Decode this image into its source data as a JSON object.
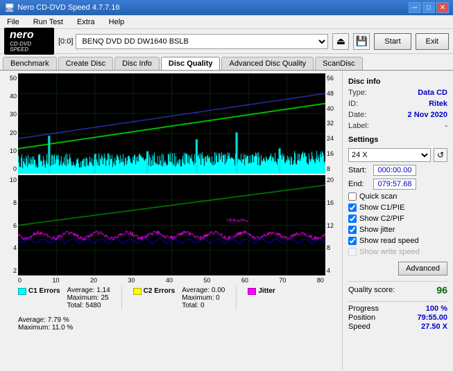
{
  "titleBar": {
    "title": "Nero CD-DVD Speed 4.7.7.16",
    "icon": "●",
    "controls": [
      "─",
      "□",
      "✕"
    ]
  },
  "menuBar": {
    "items": [
      "File",
      "Run Test",
      "Extra",
      "Help"
    ]
  },
  "toolbar": {
    "logo_top": "nero",
    "logo_bottom": "CD·DVD SPEED",
    "drive_label": "[0:0]",
    "drive_value": "BENQ DVD DD DW1640 BSLB",
    "eject_icon": "⏏",
    "save_icon": "💾",
    "start_label": "Start",
    "exit_label": "Exit"
  },
  "tabs": [
    {
      "label": "Benchmark",
      "active": false
    },
    {
      "label": "Create Disc",
      "active": false
    },
    {
      "label": "Disc Info",
      "active": false
    },
    {
      "label": "Disc Quality",
      "active": true
    },
    {
      "label": "Advanced Disc Quality",
      "active": false
    },
    {
      "label": "ScanDisc",
      "active": false
    }
  ],
  "topChart": {
    "yLeft": [
      "50",
      "40",
      "30",
      "20",
      "10",
      "0"
    ],
    "yRight": [
      "56",
      "48",
      "40",
      "32",
      "24",
      "16",
      "8"
    ],
    "xAxis": [
      "0",
      "10",
      "20",
      "30",
      "40",
      "50",
      "60",
      "70",
      "80"
    ]
  },
  "bottomChart": {
    "yLeft": [
      "10",
      "8",
      "6",
      "4",
      "2"
    ],
    "yRight": [
      "20",
      "16",
      "12",
      "8",
      "4"
    ],
    "xAxis": [
      "0",
      "10",
      "20",
      "30",
      "40",
      "50",
      "60",
      "70",
      "80"
    ]
  },
  "stats": {
    "c1": {
      "label": "C1 Errors",
      "color": "#00ffff",
      "average_label": "Average:",
      "average_val": "1.14",
      "maximum_label": "Maximum:",
      "maximum_val": "25",
      "total_label": "Total:",
      "total_val": "5480"
    },
    "c2": {
      "label": "C2 Errors",
      "color": "#ffff00",
      "average_label": "Average:",
      "average_val": "0.00",
      "maximum_label": "Maximum:",
      "maximum_val": "0",
      "total_label": "Total:",
      "total_val": "0"
    },
    "jitter": {
      "label": "Jitter",
      "color": "#ff00ff",
      "average_label": "Average:",
      "average_val": "7.79 %",
      "maximum_label": "Maximum:",
      "maximum_val": "11.0 %"
    }
  },
  "discInfo": {
    "section_label": "Disc info",
    "type_label": "Type:",
    "type_val": "Data CD",
    "id_label": "ID:",
    "id_val": "Ritek",
    "date_label": "Date:",
    "date_val": "2 Nov 2020",
    "label_label": "Label:",
    "label_val": "-"
  },
  "settings": {
    "section_label": "Settings",
    "speed_value": "24 X",
    "refresh_icon": "↺",
    "start_label": "Start:",
    "start_val": "000:00.00",
    "end_label": "End:",
    "end_val": "079:57.68",
    "quick_scan_label": "Quick scan",
    "quick_scan_checked": false,
    "show_c1_pie_label": "Show C1/PIE",
    "show_c1_pie_checked": true,
    "show_c2_pif_label": "Show C2/PIF",
    "show_c2_pif_checked": true,
    "show_jitter_label": "Show jitter",
    "show_jitter_checked": true,
    "show_read_speed_label": "Show read speed",
    "show_read_speed_checked": true,
    "show_write_speed_label": "Show write speed",
    "show_write_speed_checked": false,
    "advanced_label": "Advanced"
  },
  "quality": {
    "label": "Quality score:",
    "score": "96"
  },
  "progress": {
    "progress_label": "Progress",
    "progress_val": "100 %",
    "position_label": "Position",
    "position_val": "79:55.00",
    "speed_label": "Speed",
    "speed_val": "27.50 X"
  }
}
